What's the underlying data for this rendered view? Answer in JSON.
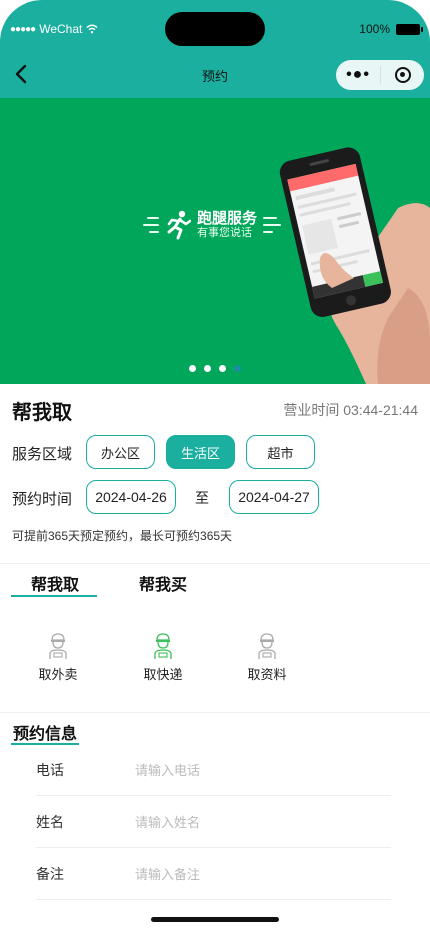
{
  "status_bar": {
    "carrier_dots": "●●●●●",
    "carrier": "WeChat",
    "battery": "100%"
  },
  "nav": {
    "title": "预约",
    "more": "•●•"
  },
  "banner": {
    "logo_main": "跑腿服务",
    "logo_sub": "有事您说话",
    "slide_count": 4,
    "active_slide": 4
  },
  "service": {
    "title": "帮我取",
    "hours": "营业时间 03:44-21:44",
    "area_label": "服务区域",
    "areas": [
      "办公区",
      "生活区",
      "超市"
    ],
    "selected_area": "生活区",
    "time_label": "预约时间",
    "date_from": "2024-04-26",
    "to_label": "至",
    "date_to": "2024-04-27",
    "hint": "可提前365天预定预约，最长可预约365天"
  },
  "tabs": [
    "帮我取",
    "帮我买"
  ],
  "active_tab": "帮我取",
  "categories": [
    {
      "label": "取外卖",
      "icon": "delivery-person-icon",
      "color": "#aaaaaa"
    },
    {
      "label": "取快递",
      "icon": "delivery-person-icon",
      "color": "#3cc05a"
    },
    {
      "label": "取资料",
      "icon": "delivery-person-icon",
      "color": "#aaaaaa"
    }
  ],
  "reservation": {
    "title": "预约信息",
    "fields": [
      {
        "label": "电话",
        "placeholder": "请输入电话"
      },
      {
        "label": "姓名",
        "placeholder": "请输入姓名"
      },
      {
        "label": "备注",
        "placeholder": "请输入备注"
      }
    ]
  },
  "colors": {
    "accent": "#1aaf9f",
    "banner_bg": "#00a65a"
  }
}
